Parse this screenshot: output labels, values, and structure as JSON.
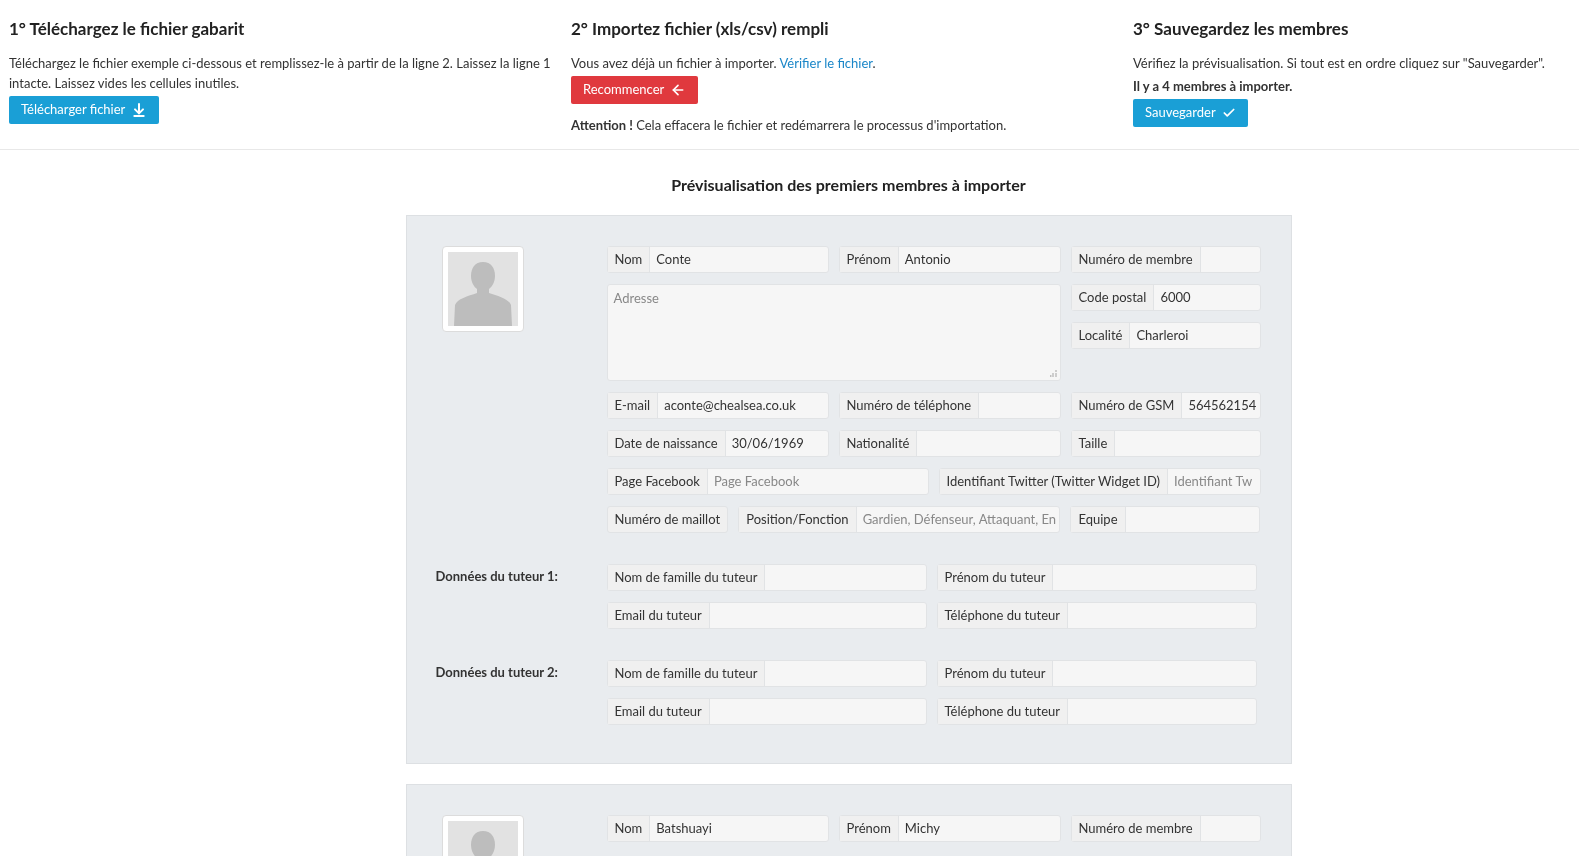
{
  "steps": [
    {
      "title": "1° Téléchargez le fichier gabarit",
      "paragraphs": [
        {
          "text": "Téléchargez le fichier exemple ci-dessous et remplissez-le à partir de la ligne 2. Laissez la ligne 1 intacte. Laissez vides les cellules inutiles."
        }
      ],
      "button": {
        "label": "Télécharger fichier",
        "kind": "download",
        "color": "#1a9fd6"
      }
    },
    {
      "title": "2° Importez fichier (xls/csv) rempli",
      "paragraphs": [
        {
          "text": "Vous avez déjà un fichier à importer.",
          "link": "Vérifier le fichier",
          "after_link": "."
        }
      ],
      "button": {
        "label": "Recommencer",
        "kind": "back",
        "color": "#e0393e"
      },
      "note": "**Attention !** Cela effacera le fichier et redémarrera le processus d'importation."
    },
    {
      "title": "3° Sauvegardez les membres",
      "paragraphs": [
        {
          "text": "Vérifiez la prévisualisation. Si tout est en ordre cliquez sur \"Sauvegarder\"."
        },
        {
          "text": "Il y a 4 membres à importer.",
          "bold": true
        }
      ],
      "button": {
        "label": "Sauvegarder",
        "kind": "check",
        "color": "#1a9fd6"
      }
    }
  ],
  "preview_title": "Prévisualisation des premiers membres à importer",
  "members": [
    {
      "rows": [
        {
          "kind": "triple",
          "fields": [
            {
              "label": "Nom",
              "value": "Conte"
            },
            {
              "label": "Prénom",
              "value": "Antonio"
            },
            {
              "label": "Numéro de membre"
            }
          ]
        },
        {
          "kind": "address",
          "fields": [
            {
              "placeholder": "Adresse"
            },
            {
              "label": "Code postal",
              "value": "6000"
            },
            {
              "label": "Localité",
              "value": "Charleroi"
            }
          ]
        },
        {
          "kind": "triple",
          "fields": [
            {
              "label": "E-mail",
              "value": "aconte@chealsea.co.uk"
            },
            {
              "label": "Numéro de téléphone"
            },
            {
              "label": "Numéro de GSM",
              "value": "564562154"
            }
          ]
        },
        {
          "kind": "triple",
          "fields": [
            {
              "label": "Date de naissance",
              "value": "30/06/1969"
            },
            {
              "label": "Nationalité"
            },
            {
              "label": "Taille"
            }
          ]
        },
        {
          "kind": "double",
          "fields": [
            {
              "label": "Page Facebook",
              "placeholder": "Page Facebook"
            },
            {
              "label": "Identifiant Twitter (Twitter Widget ID)",
              "placeholder": "Identifiant Tw"
            }
          ]
        },
        {
          "kind": "jersey",
          "fields": [
            {
              "label": "Numéro de maillot"
            },
            {
              "label": "Position/Fonction",
              "placeholder": "Gardien, Défenseur, Attaquant, En"
            },
            {
              "label": "Equipe"
            }
          ]
        }
      ],
      "tutors": [
        {
          "heading": "Données du tuteur 1:",
          "rows": [
            [
              {
                "label": "Nom de famille du tuteur"
              },
              {
                "label": "Prénom du tuteur"
              }
            ],
            [
              {
                "label": "Email du tuteur"
              },
              {
                "label": "Téléphone du tuteur"
              }
            ]
          ]
        },
        {
          "heading": "Données du tuteur 2:",
          "rows": [
            [
              {
                "label": "Nom de famille du tuteur"
              },
              {
                "label": "Prénom du tuteur"
              }
            ],
            [
              {
                "label": "Email du tuteur"
              },
              {
                "label": "Téléphone du tuteur"
              }
            ]
          ]
        }
      ]
    },
    {
      "rows": [
        {
          "kind": "triple",
          "fields": [
            {
              "label": "Nom",
              "value": "Batshuayi"
            },
            {
              "label": "Prénom",
              "value": "Michy"
            },
            {
              "label": "Numéro de membre"
            }
          ]
        }
      ]
    }
  ]
}
